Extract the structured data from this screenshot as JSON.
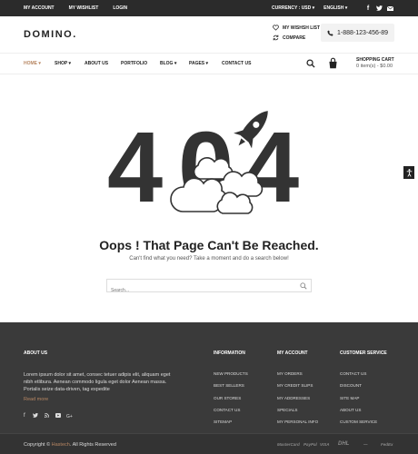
{
  "topbar": {
    "my_account": "MY ACCOUNT",
    "my_wishlist": "MY WISHLIST",
    "login": "LOGIN",
    "currency": "CURRENCY : USD",
    "language": "ENGLISH",
    "social_icons": [
      "facebook-icon",
      "twitter-icon",
      "mail-icon"
    ]
  },
  "header": {
    "logo": "DOMINO.",
    "wishlist": "MY WISHSH LIST",
    "compare": "COMPARE",
    "phone": "1-888-123-456-89"
  },
  "nav": {
    "items": [
      {
        "label": "HOME",
        "dropdown": true,
        "active": true
      },
      {
        "label": "SHOP",
        "dropdown": true
      },
      {
        "label": "ABOUT US"
      },
      {
        "label": "PORTFOLIO"
      },
      {
        "label": "BLOG",
        "dropdown": true
      },
      {
        "label": "PAGES",
        "dropdown": true
      },
      {
        "label": "CONTACT US"
      }
    ],
    "cart_title": "SHOPPING CART",
    "cart_summary": "0 item(s) - $0.00"
  },
  "error": {
    "code": "404",
    "title": "Oops ! That Page Can't Be Reached.",
    "subtitle": "Can't find what you need? Take a moment and do a search below!",
    "search_placeholder": "Search..."
  },
  "footer": {
    "about": {
      "heading": "ABOUT US",
      "text": "Lorem ipsum dolor sit amet, consec tetuer adipis elit, aliquam eget nibh etlibura. Aenean commodo ligula eget dolor Aenean massa. Portalis seize data-driven, tag expedite",
      "read_more": "Read more"
    },
    "information": {
      "heading": "INFORMATION",
      "links": [
        "NEW PRODUCTS",
        "BEST SELLERS",
        "OUR STORES",
        "CONTACT US",
        "SITEMAP"
      ]
    },
    "my_account": {
      "heading": "MY ACCOUNT",
      "links": [
        "MY ORDERS",
        "MY CREDIT SLIPS",
        "MY ADDRESSES",
        "SPECIALS",
        "MY PERSONAL INFO"
      ]
    },
    "customer_service": {
      "heading": "CUSTOMER SERVICE",
      "links": [
        "CONTACT US",
        "DISCOUNT",
        "SITE MAP",
        "ABOUT US",
        "CUSTOM SERVICE"
      ]
    },
    "copyright_prefix": "Copyright ©",
    "copyright_brand": "Hastech",
    "copyright_suffix": ". All Rights Reserved",
    "payments": [
      "MasterCard",
      "PayPal",
      "VISA",
      "DHL",
      "—",
      "FedEx"
    ]
  },
  "colors": {
    "accent": "#b88763",
    "dark": "#2b2b2b",
    "footer": "#3a3a3a"
  }
}
